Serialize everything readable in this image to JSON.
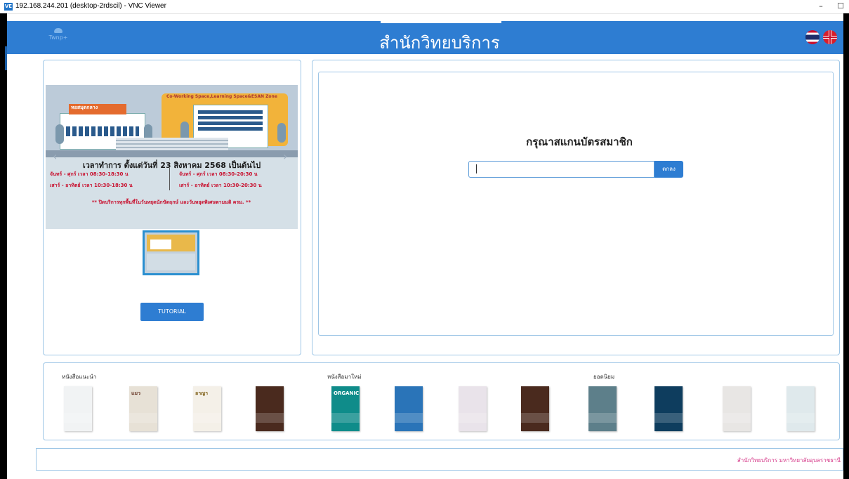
{
  "window": {
    "title": "192.168.244.201 (desktop-2rdscil) - VNC Viewer",
    "app_badge": "VE",
    "minimize": "–",
    "maximize": "☐"
  },
  "header": {
    "logo_text": "Twnp+",
    "title": "สำนักวิทยบริการ",
    "lang_th": "TH",
    "lang_en": "EN"
  },
  "poster": {
    "corner_label": "Co-Working Space,Learning Space&ESAN Zone",
    "building_label": "หอสมุดกลาง",
    "hours_title": "เวลาทำการ ตั้งแต่วันที่ 23 สิงหาคม 2568 เป็นต้นไป",
    "left_weekday": "จันทร์ - ศุกร์  เวลา  08:30-18:30 น",
    "left_weekend": "เสาร์ - อาทิตย์  เวลา  10:30-18:30 น",
    "right_weekday": "จันทร์ - ศุกร์  เวลา  08:30-20:30 น",
    "right_weekend": "เสาร์ - อาทิตย์  เวลา  10:30-20:30 น",
    "notice": "** ปิดบริการทุกพื้นที่ในวันหยุดนักขัตฤกษ์ และวันหยุดพิเศษตามมติ ครม. **",
    "prev": "‹",
    "next": "›"
  },
  "left_panel": {
    "tutorial_label": "TUTORIAL"
  },
  "scan": {
    "title": "กรุณาสแกนบัตรสมาชิก",
    "input_value": "",
    "button_label": "ตกลง"
  },
  "books": {
    "recommended_label": "หนังสือแนะนำ",
    "new_label": "หนังสือมาใหม่",
    "popular_label": "ยอดนิยม",
    "items": [
      {
        "title": "",
        "bg": "#f1f3f4",
        "fg": "#777"
      },
      {
        "title": "แมว",
        "bg": "#e7e1d6",
        "fg": "#6b3a2a"
      },
      {
        "title": "อาญา",
        "bg": "#f4f0e8",
        "fg": "#7a5a10"
      },
      {
        "title": "",
        "bg": "#4a2a1e",
        "fg": "#fff"
      },
      {
        "title": "ORGANIC",
        "bg": "#0f8c8a",
        "fg": "#fff"
      },
      {
        "title": "",
        "bg": "#2a74b8",
        "fg": "#fff"
      },
      {
        "title": "",
        "bg": "#e9e3ea",
        "fg": "#555"
      },
      {
        "title": "",
        "bg": "#4a2a1e",
        "fg": "#fff"
      },
      {
        "title": "",
        "bg": "#5d7f8a",
        "fg": "#fff"
      },
      {
        "title": "",
        "bg": "#0e3d5e",
        "fg": "#fff"
      },
      {
        "title": "",
        "bg": "#e8e6e4",
        "fg": "#333"
      },
      {
        "title": "",
        "bg": "#dfe9ec",
        "fg": "#333"
      }
    ]
  },
  "footer": {
    "text": "สำนักวิทยบริการ มหาวิทยาลัยอุบลราชธานี"
  }
}
